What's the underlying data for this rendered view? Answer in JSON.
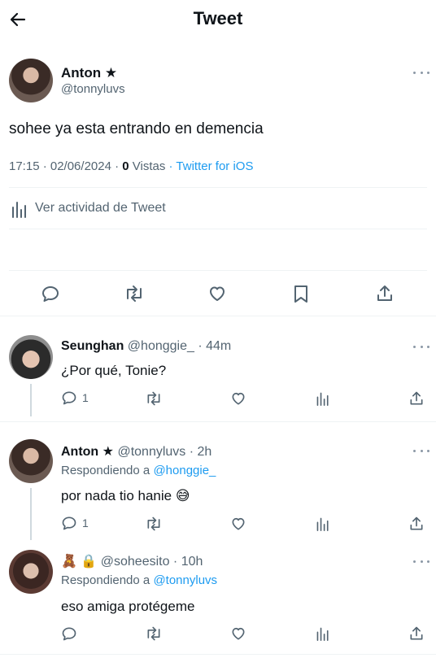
{
  "header": {
    "title": "Tweet"
  },
  "main_tweet": {
    "name": "Anton ★",
    "handle": "@tonnyluvs",
    "text": "sohee ya esta entrando en demencia",
    "time": "17:15 · 02/06/2024 · ",
    "views_count": "0",
    "views_label": " Vistas",
    "source": " · Twitter for iOS",
    "activity_label": "Ver actividad de Tweet"
  },
  "replies": [
    {
      "name": "Seunghan",
      "handle": "@honggie_",
      "time": " · 44m",
      "text": "¿Por qué, Tonie?",
      "reply_count": "1"
    },
    {
      "name": "Anton ★",
      "handle": "@tonnyluvs",
      "time": " · 2h",
      "replying_prefix": "Respondiendo a ",
      "replying_to": "@honggie_",
      "text": "por nada tio hanie",
      "emoji": "😅",
      "reply_count": "1"
    },
    {
      "name_emoji": "🧸",
      "lock": "🔒",
      "handle": "@soheesito",
      "time": " · 10h",
      "replying_prefix": "Respondiendo a ",
      "replying_to": "@tonnyluvs",
      "text": "eso amiga protégeme"
    }
  ],
  "colors": {
    "accent": "#1d9bf0",
    "muted": "#536471",
    "divider": "#eff3f4"
  }
}
